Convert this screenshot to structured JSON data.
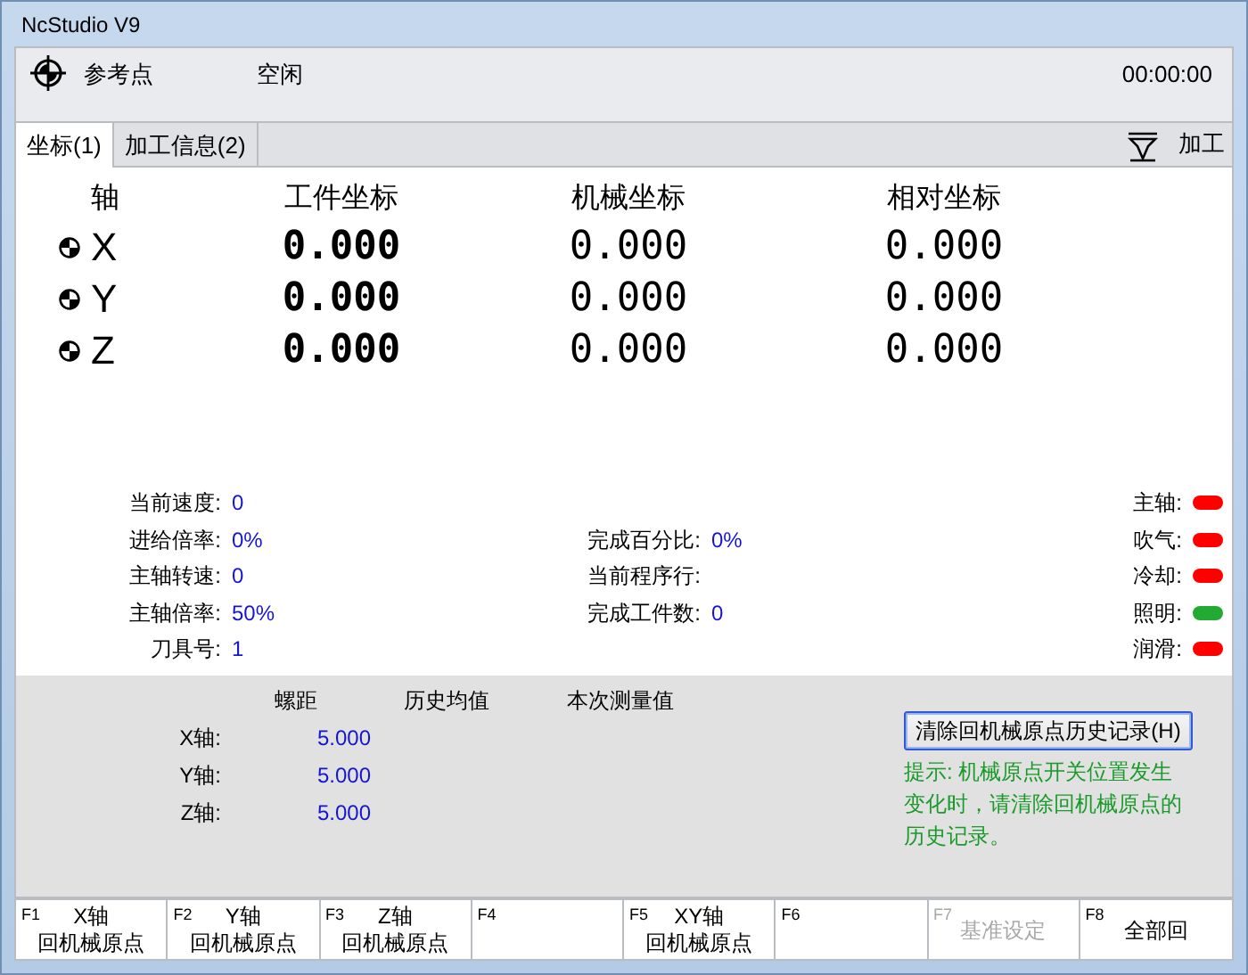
{
  "window": {
    "title": "NcStudio V9"
  },
  "status": {
    "mode": "参考点",
    "state": "空闲",
    "time": "00:00:00"
  },
  "tabs": [
    {
      "label": "坐标(1)",
      "selected": true
    },
    {
      "label": "加工信息(2)",
      "selected": false
    }
  ],
  "process_button": {
    "label": "加工"
  },
  "coordinates": {
    "columns": [
      "轴",
      "工件坐标",
      "机械坐标",
      "相对坐标"
    ],
    "rows": [
      {
        "axis": "X",
        "work": "0.000",
        "machine": "0.000",
        "relative": "0.000"
      },
      {
        "axis": "Y",
        "work": "0.000",
        "machine": "0.000",
        "relative": "0.000"
      },
      {
        "axis": "Z",
        "work": "0.000",
        "machine": "0.000",
        "relative": "0.000"
      }
    ]
  },
  "info_left": [
    {
      "label": "当前速度:",
      "value": "0"
    },
    {
      "label": "进给倍率:",
      "value": "0%"
    },
    {
      "label": "主轴转速:",
      "value": "0"
    },
    {
      "label": "主轴倍率:",
      "value": "50%"
    },
    {
      "label": "刀具号:",
      "value": "1"
    }
  ],
  "info_middle": [
    {
      "label": "完成百分比:",
      "value": "0%"
    },
    {
      "label": "当前程序行:"
    },
    {
      "label": "完成工件数:",
      "value": "0"
    }
  ],
  "indicators": [
    {
      "label": "主轴:",
      "color": "#ff0000"
    },
    {
      "label": "吹气:",
      "color": "#ff0000"
    },
    {
      "label": "冷却:",
      "color": "#ff0000"
    },
    {
      "label": "照明:",
      "color": "#22aa33"
    },
    {
      "label": "润滑:",
      "color": "#ff0000"
    }
  ],
  "pitch": {
    "columns": [
      "螺距",
      "历史均值",
      "本次测量值"
    ],
    "rows": [
      {
        "axis": "X轴:",
        "pitch": "5.000"
      },
      {
        "axis": "Y轴:",
        "pitch": "5.000"
      },
      {
        "axis": "Z轴:",
        "pitch": "5.000"
      }
    ]
  },
  "clear_button": {
    "label": "清除回机械原点历史记录(H)"
  },
  "hint": "提示: 机械原点开关位置发生变化时，请清除回机械原点的历史记录。",
  "function_keys": [
    {
      "key": "F1",
      "lines": [
        "X轴",
        "回机械原点"
      ],
      "disabled": false
    },
    {
      "key": "F2",
      "lines": [
        "Y轴",
        "回机械原点"
      ],
      "disabled": false
    },
    {
      "key": "F3",
      "lines": [
        "Z轴",
        "回机械原点"
      ],
      "disabled": false
    },
    {
      "key": "F4",
      "disabled": false
    },
    {
      "key": "F5",
      "lines": [
        "XY轴",
        "回机械原点"
      ],
      "disabled": false
    },
    {
      "key": "F6",
      "disabled": false
    },
    {
      "key": "F7",
      "lines": [
        "基准设定"
      ],
      "disabled": true
    },
    {
      "key": "F8",
      "lines": [
        "全部回"
      ],
      "disabled": false
    }
  ]
}
